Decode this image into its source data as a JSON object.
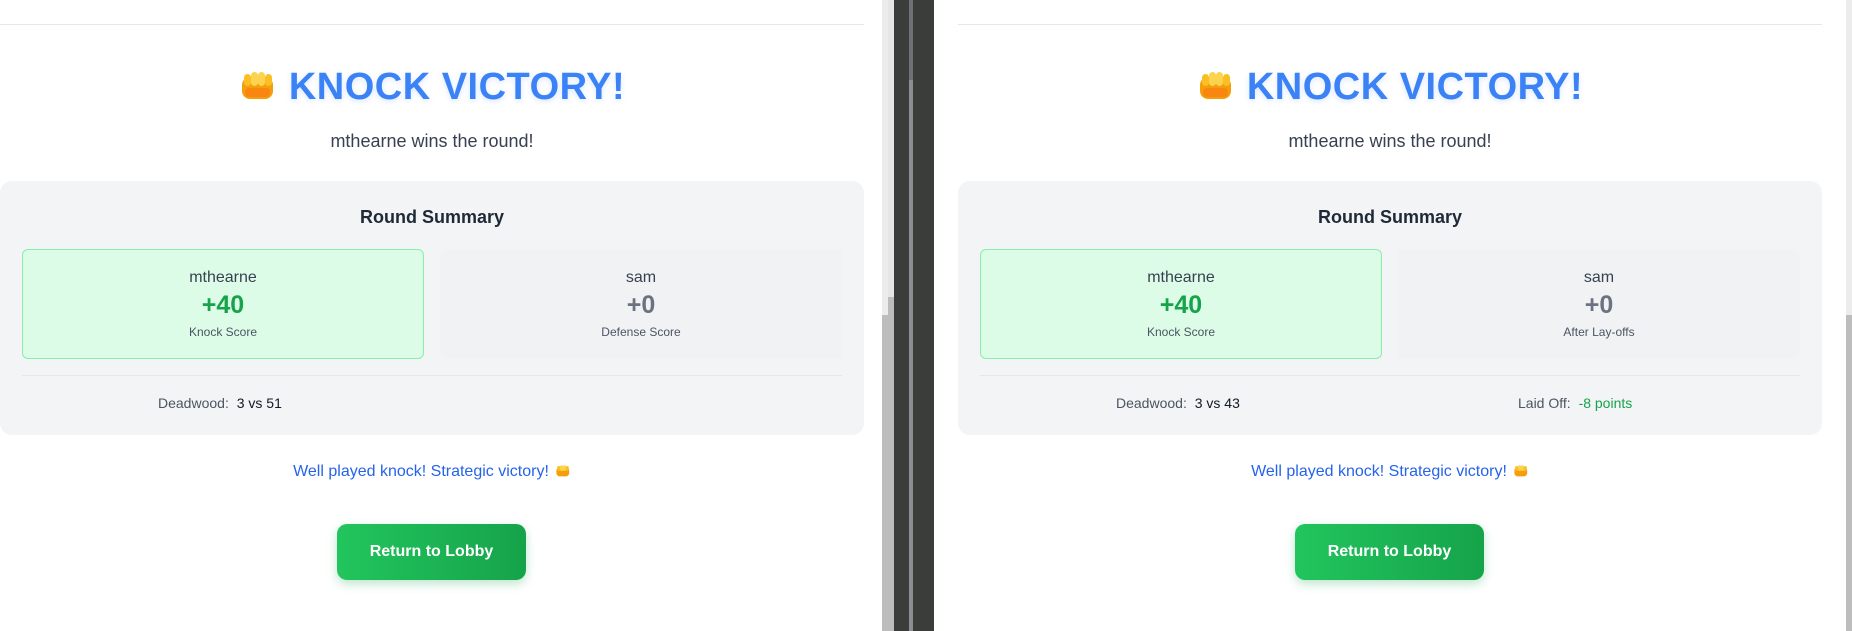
{
  "colors": {
    "accent": "#3b82f6",
    "win_green": "#16a34a",
    "win_bg": "#dcfce7",
    "message_blue": "#2563eb"
  },
  "left_panel": {
    "title_icon": "oncoming-fist-icon",
    "title": "KNOCK VICTORY!",
    "subtitle": "mthearne wins the round!",
    "summary": {
      "title": "Round Summary",
      "winner": {
        "name": "mthearne",
        "score": "+40",
        "label": "Knock Score"
      },
      "loser": {
        "name": "sam",
        "score": "+0",
        "label": "Defense Score"
      },
      "deadwood_label": "Deadwood:",
      "deadwood_value": "3 vs 51"
    },
    "message": "Well played knock! Strategic victory!",
    "button_label": "Return to Lobby"
  },
  "right_panel": {
    "title_icon": "oncoming-fist-icon",
    "title": "KNOCK VICTORY!",
    "subtitle": "mthearne wins the round!",
    "summary": {
      "title": "Round Summary",
      "winner": {
        "name": "mthearne",
        "score": "+40",
        "label": "Knock Score"
      },
      "loser": {
        "name": "sam",
        "score": "+0",
        "label": "After Lay-offs"
      },
      "deadwood_label": "Deadwood:",
      "deadwood_value": "3 vs 43",
      "laid_off_label": "Laid Off:",
      "laid_off_value": "-8 points"
    },
    "message": "Well played knock! Strategic victory!",
    "button_label": "Return to Lobby"
  }
}
